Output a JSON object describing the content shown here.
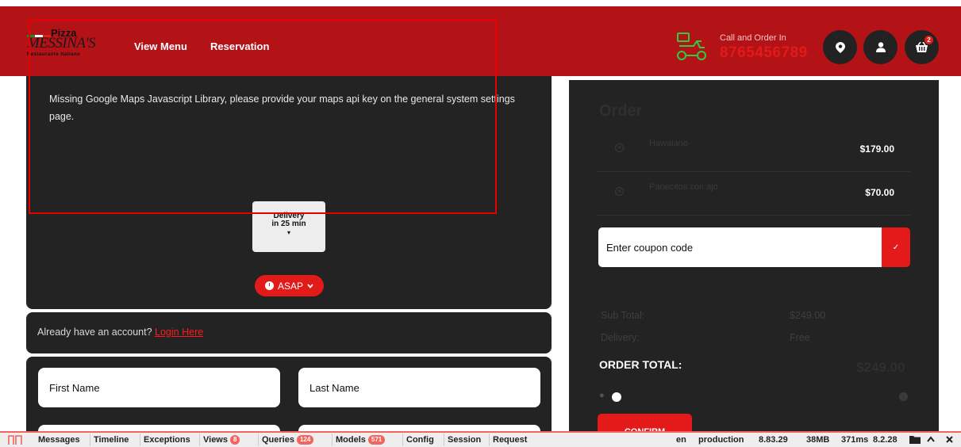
{
  "header": {
    "logo": {
      "line1": "Pizza",
      "line2": "MESSINA'S",
      "line3": "Restaurante Italiano"
    },
    "nav": [
      "View Menu",
      "Reservation"
    ],
    "call_label": "Call and Order In",
    "phone": "8765456789",
    "cart_count": "2",
    "icons": [
      "scooter-icon",
      "location-pin-icon",
      "user-icon",
      "basket-icon"
    ]
  },
  "map": {
    "message": "Missing Google Maps Javascript Library, please provide your maps api key on the general system settings page.",
    "delivery_line1": "Delivery",
    "delivery_line2": "in 25 min",
    "caret": "▾",
    "asap": "ASAP"
  },
  "account": {
    "prompt": "Already have an account?",
    "login": "Login Here"
  },
  "form": {
    "first_name_placeholder": "First Name",
    "last_name_placeholder": "Last Name"
  },
  "order": {
    "title": "Order",
    "items": [
      {
        "name": "Hawaiano",
        "price": "$179.00"
      },
      {
        "name": "Panecitos con ajo",
        "price": "$70.00"
      }
    ],
    "coupon_placeholder": "Enter coupon code",
    "coupon_button": "✓",
    "subtotal_label": "Sub Total:",
    "subtotal_value": "$249.00",
    "delivery_label": "Delivery:",
    "delivery_value": "Free",
    "total_label": "ORDER TOTAL:",
    "total_value": "$249.00",
    "confirm": "CONFIRM"
  },
  "debugbar": {
    "tabs": [
      {
        "label": "Messages"
      },
      {
        "label": "Timeline"
      },
      {
        "label": "Exceptions"
      },
      {
        "label": "Views",
        "badge": "8"
      },
      {
        "label": "Queries",
        "badge": "124"
      },
      {
        "label": "Models",
        "badge": "571"
      },
      {
        "label": "Config"
      },
      {
        "label": "Session"
      },
      {
        "label": "Request"
      }
    ],
    "locale": "en",
    "env": "production",
    "laravel_version": "8.83.29",
    "memory": "38MB",
    "time": "371ms",
    "php_version": "8.2.28"
  },
  "colors": {
    "brand_red": "#b31217",
    "accent_red": "#e21a1a",
    "panel": "#232323",
    "debug_accent": "#f4645f"
  }
}
